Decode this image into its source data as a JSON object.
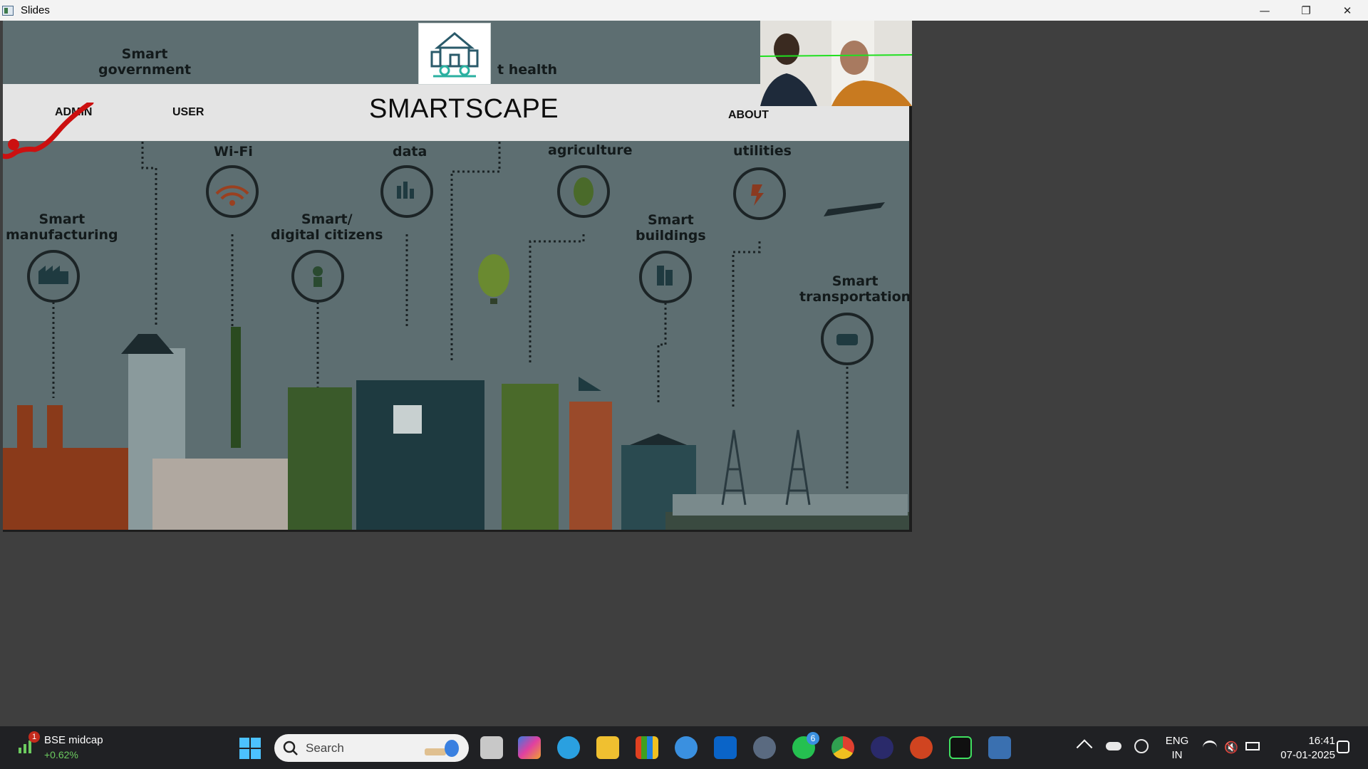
{
  "window": {
    "title": "Slides",
    "controls": {
      "minimize": "—",
      "restore": "❐",
      "close": "✕"
    }
  },
  "slide": {
    "nav": {
      "admin": "ADMIN",
      "user": "USER",
      "about": "ABOUT",
      "title": "SMARTSCAPE"
    },
    "scene_labels": {
      "government": "Smart\ngovernment",
      "health": "t health",
      "wifi": "Wi-Fi",
      "data": "data",
      "agriculture": "agriculture",
      "utilities": "utilities",
      "manufacturing": "Smart\nmanufacturing",
      "citizens": "Smart/\ndigital citizens",
      "buildings": "Smart\nbuildings",
      "transportation": "Smart\ntransportation"
    }
  },
  "taskbar": {
    "stock": {
      "name": "BSE midcap",
      "change": "+0.62%",
      "badge": "1"
    },
    "search_placeholder": "Search",
    "whatsapp_badge": "6",
    "language": {
      "line1": "ENG",
      "line2": "IN"
    },
    "time": "16:41",
    "date": "07-01-2025"
  },
  "colors": {
    "slide_bg": "#5d6e71",
    "navbar_bg": "#e4e4e4",
    "accent_icon": "#4cc2ff"
  }
}
